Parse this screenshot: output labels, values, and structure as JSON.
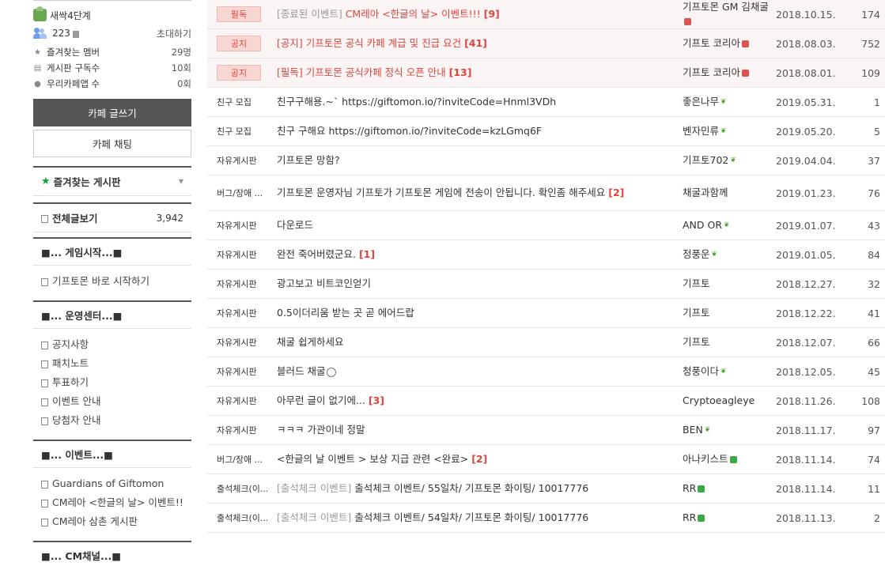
{
  "sidebar": {
    "level": "새싹4단계",
    "member_count": "223",
    "invite": "초대하기",
    "stats": [
      {
        "label": "즐겨찾는 멤버",
        "value": "29명",
        "icon": "star-icon"
      },
      {
        "label": "게시판 구독수",
        "value": "10회",
        "icon": "rss-icon"
      },
      {
        "label": "우리카페앱 수",
        "value": "0회",
        "icon": "app-icon"
      }
    ],
    "write_button": "카페 글쓰기",
    "chat_button": "카페 채팅",
    "favorites_title": "즐겨찾는 게시판",
    "all_posts_label": "전체글보기",
    "all_posts_count": "3,942",
    "sections": [
      {
        "title": "■... 게임시작...■",
        "items": [
          "기프토몬 바로 시작하기"
        ]
      },
      {
        "title": "■... 운영센터...■",
        "items": [
          "공지사항",
          "패치노트",
          "투표하기",
          "이벤트 안내",
          "당첨자 안내"
        ]
      },
      {
        "title": "■... 이벤트...■",
        "items": [
          "Guardians of Giftomon",
          "CM레아 <한글의 날> 이벤트!!",
          "CM레아 삼촌 게시판"
        ]
      },
      {
        "title": "■... CM채널...■",
        "items": []
      }
    ]
  },
  "board": {
    "rows": [
      {
        "type": "notice",
        "category": "필독",
        "prefix": "[종료된 이벤트] ",
        "title": "CM레아 <한글의 날> 이벤트!!!",
        "comments": "[9]",
        "author": "기프토몬 GM 김채굴",
        "grade": "box-red",
        "date": "2018.10.15.",
        "views": "174"
      },
      {
        "type": "notice",
        "category": "공지",
        "prefix": "",
        "title": "[공지] 기프토몬 공식 카페 계급 및 진급 요건",
        "comments": "[41]",
        "author": "기프토 코리아",
        "grade": "box-red",
        "date": "2018.08.03.",
        "views": "752"
      },
      {
        "type": "notice",
        "category": "공지",
        "prefix": "",
        "title": "[필독] 기프토몬 공식카페 정식 오픈 안내",
        "comments": "[13]",
        "author": "기프토 코리아",
        "grade": "box-red",
        "date": "2018.08.01.",
        "views": "109"
      },
      {
        "type": "normal",
        "category": "친구 모집",
        "prefix": "",
        "title": "친구구해용.~` https://giftomon.io/?inviteCode=Hnml3VDh",
        "comments": "",
        "author": "좋은나무",
        "grade": "leaf",
        "date": "2019.05.31.",
        "views": "1"
      },
      {
        "type": "normal",
        "category": "친구 모집",
        "prefix": "",
        "title": "친구 구해요 https://giftomon.io/?inviteCode=kzLGmq6F",
        "comments": "",
        "author": "벤자민류",
        "grade": "leaf",
        "date": "2019.05.20.",
        "views": "5"
      },
      {
        "type": "normal",
        "category": "자유게시판",
        "prefix": "",
        "title": "기프토몬 망함?",
        "comments": "",
        "author": "기프토702",
        "grade": "leaf",
        "date": "2019.04.04.",
        "views": "37"
      },
      {
        "type": "tall",
        "category": "버그/장애 ...",
        "prefix": "",
        "title": "기프토몬 운영자님 기프토가 기프토몬 게임에 전송이 안됩니다. 확인좀 해주세요",
        "comments": "[2]",
        "author": "채굴과함께",
        "grade": "",
        "date": "2019.01.23.",
        "views": "76"
      },
      {
        "type": "normal",
        "category": "자유게시판",
        "prefix": "",
        "title": "다운로드",
        "comments": "",
        "author": "AND OR",
        "grade": "leaf",
        "date": "2019.01.07.",
        "views": "43"
      },
      {
        "type": "normal",
        "category": "자유게시판",
        "prefix": "",
        "title": "완전 죽어버렸군요.",
        "comments": "[1]",
        "author": "정풍운",
        "grade": "leaf",
        "date": "2019.01.05.",
        "views": "84"
      },
      {
        "type": "normal",
        "category": "자유게시판",
        "prefix": "",
        "title": "광고보고 비트코인얻기",
        "comments": "",
        "author": "기프토",
        "grade": "",
        "date": "2018.12.27.",
        "views": "32"
      },
      {
        "type": "normal",
        "category": "자유게시판",
        "prefix": "",
        "title": "0.5이더리움 받는 곳 곧 에어드랍",
        "comments": "",
        "author": "기프토",
        "grade": "",
        "date": "2018.12.22.",
        "views": "41"
      },
      {
        "type": "normal",
        "category": "자유게시판",
        "prefix": "",
        "title": "채굴 쉽게하세요",
        "comments": "",
        "author": "기프토",
        "grade": "",
        "date": "2018.12.07.",
        "views": "66"
      },
      {
        "type": "normal",
        "category": "자유게시판",
        "prefix": "",
        "title": "블러드 채굴",
        "comments": "",
        "emoji": true,
        "author": "청풍이다",
        "grade": "leaf",
        "date": "2018.12.05.",
        "views": "45"
      },
      {
        "type": "normal",
        "category": "자유게시판",
        "prefix": "",
        "title": "아무런 글이 없기에...",
        "comments": "[3]",
        "author": "Cryptoeagleye",
        "grade": "",
        "date": "2018.11.26.",
        "views": "108"
      },
      {
        "type": "normal",
        "category": "자유게시판",
        "prefix": "",
        "title": "ㅋㅋㅋ 가관이네 정말",
        "comments": "",
        "author": "BEN",
        "grade": "leaf",
        "date": "2018.11.17.",
        "views": "97"
      },
      {
        "type": "normal",
        "category": "버그/장애 ...",
        "prefix": "",
        "title": "<한글의 날 이벤트 > 보상 지급 관련 <완료>",
        "comments": "[2]",
        "author": "아나키스트",
        "grade": "box-green",
        "date": "2018.11.14.",
        "views": "74"
      },
      {
        "type": "normal",
        "category": "출석체크(이...",
        "prefix": "[출석체크 이벤트] ",
        "title": "출석체크 이벤트/ 55일차/ 기프토몬 화이팅/ 10017776",
        "comments": "",
        "author": "RR",
        "grade": "box-green",
        "date": "2018.11.14.",
        "views": "11"
      },
      {
        "type": "normal",
        "category": "출석체크(이...",
        "prefix": "[출석체크 이벤트] ",
        "title": "출석체크 이벤트/ 54일차/ 기프토몬 화이팅/ 10017776",
        "comments": "",
        "author": "RR",
        "grade": "box-green",
        "date": "2018.11.13.",
        "views": "2"
      }
    ]
  }
}
